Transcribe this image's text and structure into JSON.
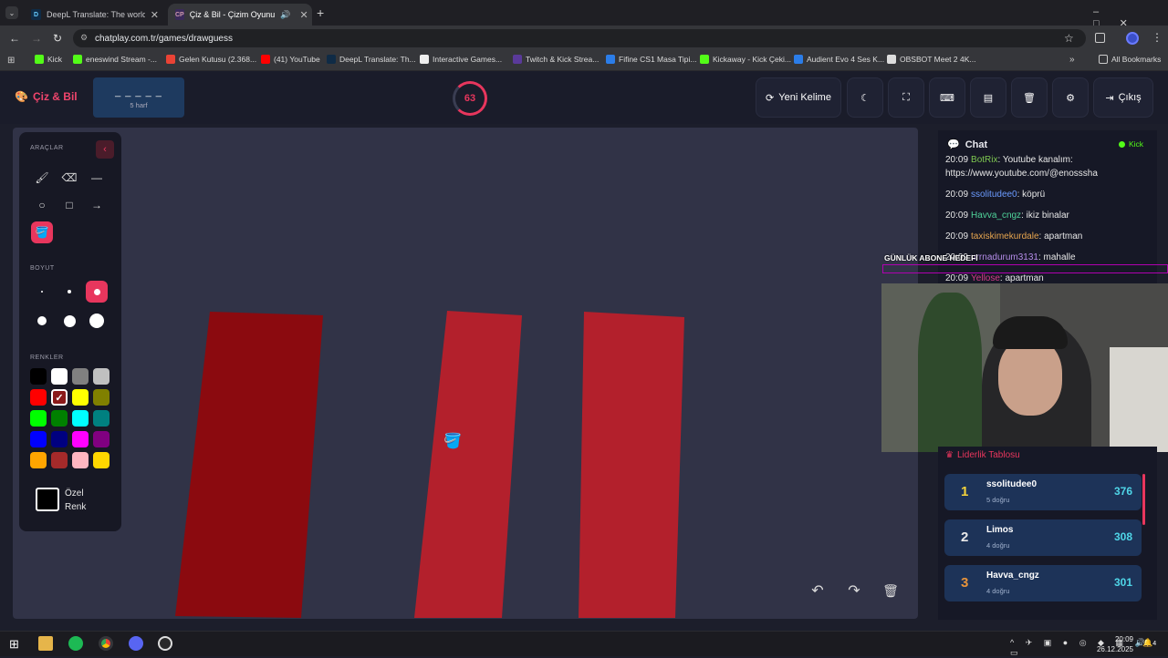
{
  "browser": {
    "tabs": [
      {
        "label": "DeepL Translate: The world's m",
        "icon": "deepl-icon",
        "close": "✕"
      },
      {
        "label": "Çiz & Bil - Çizim Oyunu",
        "icon": "chatplay-icon",
        "close": "✕",
        "fav_text": "CP"
      }
    ],
    "new_tab": "+",
    "url": "chatplay.com.tr/games/drawguess",
    "bookmarks": [
      "Kick",
      "eneswind Stream -...",
      "Gelen Kutusu (2.368...",
      "(41) YouTube",
      "DeepL Translate: Th...",
      "Interactive Games...",
      "Twitch & Kick Strea...",
      "Fifine CS1 Masa Tipi...",
      "Kickaway - Kick Çeki...",
      "Audient Evo 4 Ses K...",
      "OBSBOT Meet 2 4K..."
    ],
    "all_bookmarks": "All Bookmarks"
  },
  "header": {
    "logo": "Çiz & Bil",
    "word_blanks": "_ _ _ _ _",
    "word_hint": "5 harf",
    "timer": "63",
    "new_word": "Yeni Kelime",
    "exit": "Çıkış"
  },
  "tools": {
    "title": "ARAÇLAR",
    "size_title": "BOYUT",
    "colors_title": "RENKLER",
    "custom_color_line1": "Özel",
    "custom_color_line2": "Renk",
    "colors": [
      "#000000",
      "#ffffff",
      "#808080",
      "#c0c0c0",
      "#ff0000",
      "#8b1a1a",
      "#ffff00",
      "#808000",
      "#00ff00",
      "#008000",
      "#00ffff",
      "#008080",
      "#0000ff",
      "#000080",
      "#ff00ff",
      "#800080",
      "#ffa500",
      "#a52a2a",
      "#ffb6c1",
      "#ffd700"
    ],
    "selected_color": "#8b1a1a",
    "accent": "#e8365d"
  },
  "chat": {
    "title": "Chat",
    "platform": "Kick",
    "messages": [
      {
        "time": "20:09",
        "user": "BotRix",
        "color": "#7ec850",
        "text": ": Youtube kanalım:"
      },
      {
        "time": "",
        "user": "",
        "color": "#e8e8e8",
        "text": "https://www.youtube.com/@enosssha"
      },
      {
        "time": "20:09",
        "user": "ssolitudee0",
        "color": "#6b9bff",
        "text": ": köprü"
      },
      {
        "time": "20:09",
        "user": "Havva_cngz",
        "color": "#4fd39a",
        "text": ": ikiz binalar"
      },
      {
        "time": "20:09",
        "user": "taxiskimekurdale",
        "color": "#e8a64f",
        "text": ": apartman"
      },
      {
        "time": "20:09",
        "user": "urrnadurum3131",
        "color": "#b48ce8",
        "text": ": mahalle"
      },
      {
        "time": "20:09",
        "user": "Yellose",
        "color": "#d63a8a",
        "text": ": apartman"
      }
    ],
    "overlay_text": "GÜNLÜK ABONE HEDEFİ"
  },
  "leaderboard": {
    "title": "Liderlik Tablosu",
    "rows": [
      {
        "rank": "1",
        "name": "ssolitudee0",
        "sub": "5 doğru",
        "score": "376"
      },
      {
        "rank": "2",
        "name": "Limos",
        "sub": "4 doğru",
        "score": "308"
      },
      {
        "rank": "3",
        "name": "Havva_cngz",
        "sub": "4 doğru",
        "score": "301"
      }
    ]
  },
  "taskbar": {
    "time": "20:09",
    "date": "26.12.2025",
    "notif": "4"
  }
}
